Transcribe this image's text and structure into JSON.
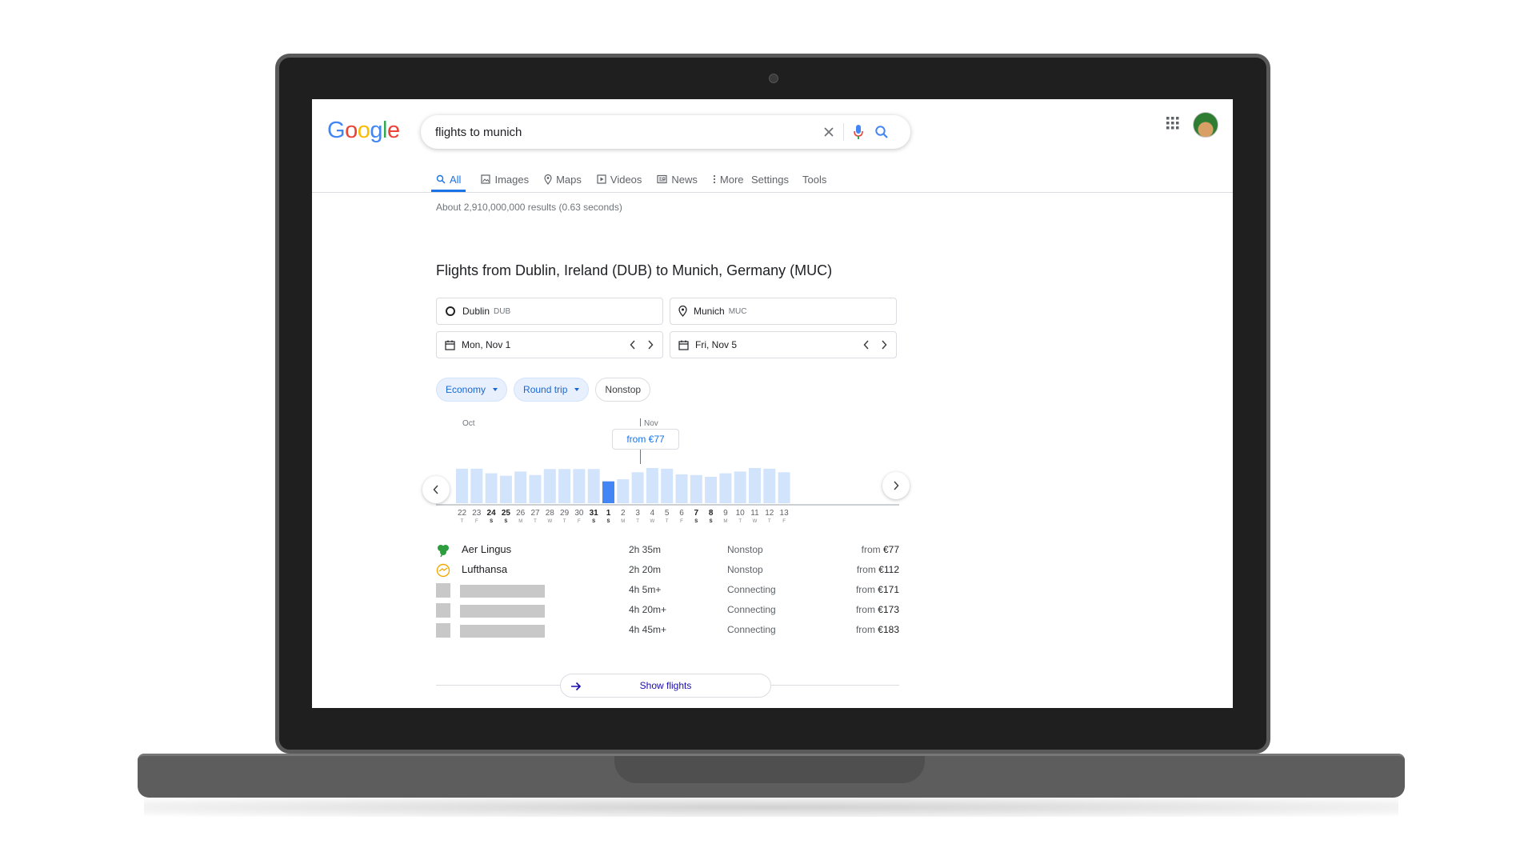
{
  "search": {
    "query": "flights to munich"
  },
  "tabs": [
    {
      "label": "All",
      "icon": "search-icon"
    },
    {
      "label": "Images",
      "icon": "image-icon"
    },
    {
      "label": "Maps",
      "icon": "map-pin-icon"
    },
    {
      "label": "Videos",
      "icon": "play-icon"
    },
    {
      "label": "News",
      "icon": "news-icon"
    },
    {
      "label": "More",
      "icon": "more-vert-icon"
    }
  ],
  "tools": {
    "settings_label": "Settings",
    "tools_label": "Tools"
  },
  "result_stats": "About 2,910,000,000 results (0.63 seconds)",
  "flights": {
    "title": "Flights from Dublin, Ireland (DUB) to Munich, Germany (MUC)",
    "origin": {
      "city": "Dublin",
      "code": "DUB"
    },
    "destination": {
      "city": "Munich",
      "code": "MUC"
    },
    "depart_date": "Mon, Nov 1",
    "return_date": "Fri, Nov 5",
    "chips": {
      "class_label": "Economy",
      "trip_label": "Round trip",
      "stops_label": "Nonstop"
    },
    "tooltip": "from €77",
    "month_oct": "Oct",
    "month_nov": "Nov",
    "show_flights_label": "Show flights",
    "results": [
      {
        "airline": "Aer Lingus",
        "duration": "2h 35m",
        "stops": "Nonstop",
        "price_prefix": "from",
        "price": "€77"
      },
      {
        "airline": "Lufthansa",
        "duration": "2h 20m",
        "stops": "Nonstop",
        "price_prefix": "from",
        "price": "€112"
      },
      {
        "airline": "",
        "duration": "4h 5m+",
        "stops": "Connecting",
        "price_prefix": "from",
        "price": "€171"
      },
      {
        "airline": "",
        "duration": "4h 20m+",
        "stops": "Connecting",
        "price_prefix": "from",
        "price": "€173"
      },
      {
        "airline": "",
        "duration": "4h 45m+",
        "stops": "Connecting",
        "price_prefix": "from",
        "price": "€183"
      }
    ]
  },
  "chart_data": {
    "type": "bar",
    "categories": [
      "22",
      "23",
      "24",
      "25",
      "26",
      "27",
      "28",
      "29",
      "30",
      "31",
      "1",
      "2",
      "3",
      "4",
      "5",
      "6",
      "7",
      "8",
      "9",
      "10",
      "11",
      "12",
      "13"
    ],
    "weekdays": [
      "T",
      "F",
      "S",
      "S",
      "M",
      "T",
      "W",
      "T",
      "F",
      "S",
      "S",
      "M",
      "T",
      "W",
      "T",
      "F",
      "S",
      "S",
      "M",
      "T",
      "W",
      "T",
      "F"
    ],
    "bold_dates": [
      "24",
      "25",
      "31",
      "1",
      "7",
      "8"
    ],
    "values": [
      0.98,
      0.98,
      0.85,
      0.78,
      0.9,
      0.8,
      0.97,
      0.97,
      0.97,
      0.97,
      0.62,
      0.68,
      0.88,
      1.0,
      0.98,
      0.82,
      0.8,
      0.75,
      0.85,
      0.9,
      1.0,
      0.98,
      0.88
    ],
    "selected_index": 10,
    "colors": {
      "bar": "#d2e3fc",
      "selected": "#4285f4"
    }
  }
}
